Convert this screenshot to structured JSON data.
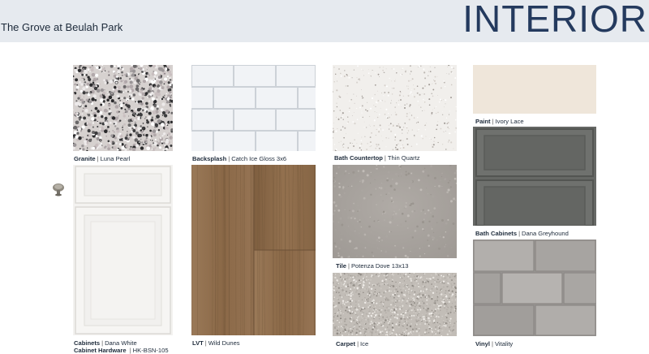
{
  "header": {
    "community": "The Grove at Beulah Park",
    "title": "INTERIOR"
  },
  "swatches": {
    "granite": {
      "category": "Granite",
      "name": "Luna Pearl"
    },
    "backsplash": {
      "category": "Backsplash",
      "name": "Catch Ice Gloss 3x6"
    },
    "bath_counter": {
      "category": "Bath Countertop",
      "name": "Thin Quartz"
    },
    "paint": {
      "category": "Paint",
      "name": "Ivory Lace"
    },
    "bath_cabinets": {
      "category": "Bath Cabinets",
      "name": "Dana Greyhound"
    },
    "tile": {
      "category": "Tile",
      "name": "Potenza Dove 13x13"
    },
    "cabinets": {
      "category": "Cabinets",
      "name": "Dana White"
    },
    "hardware": {
      "category": "Cabinet Hardware",
      "name": "HK-BSN-105"
    },
    "lvt": {
      "category": "LVT",
      "name": "Wild Dunes"
    },
    "carpet": {
      "category": "Carpet",
      "name": "Ice"
    },
    "vinyl": {
      "category": "Vinyl",
      "name": "Vitality"
    }
  },
  "colors": {
    "header_bg": "#e6eaef",
    "title": "#243a5e",
    "paint": "#efe6da",
    "bath_cabinet": "#6a6c69",
    "lvt": "#8f6e4d"
  }
}
